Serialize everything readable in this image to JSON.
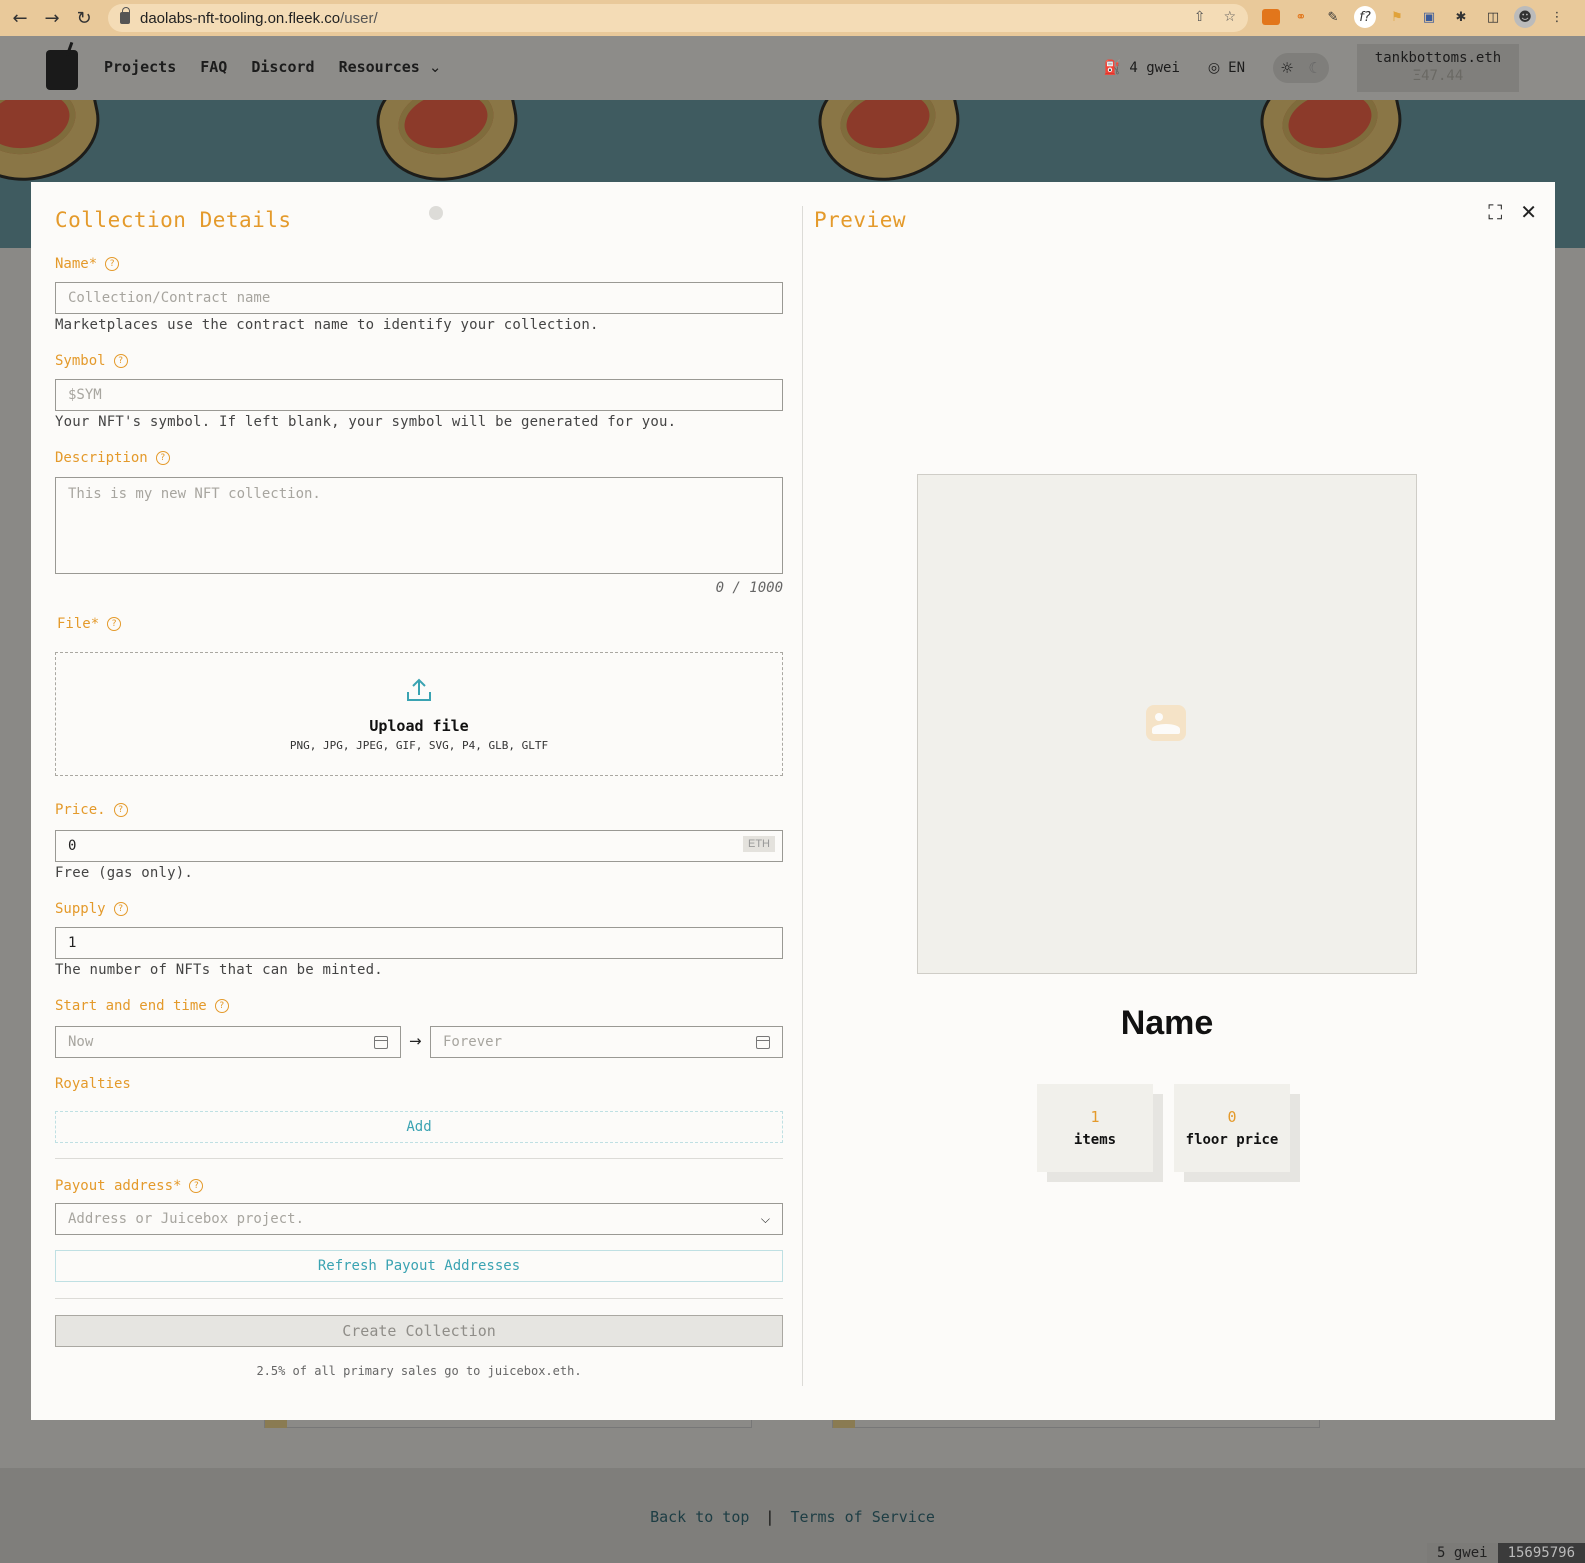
{
  "browser": {
    "url_host": "daolabs-nft-tooling.on.fleek.co",
    "url_path": "/user/"
  },
  "app": {
    "nav": [
      "Projects",
      "FAQ",
      "Discord",
      "Resources"
    ],
    "gas": "4 gwei",
    "language": "EN",
    "wallet_name": "tankbottoms.eth",
    "wallet_balance": "Ξ47.44",
    "footer_back_to_top": "Back to top",
    "footer_separator": "|",
    "footer_terms": "Terms of Service",
    "status_gas": "5 gwei",
    "status_block": "15695796"
  },
  "form": {
    "title": "Collection Details",
    "name_label": "Name*",
    "name_placeholder": "Collection/Contract name",
    "name_hint": "Marketplaces use the contract name to identify your collection.",
    "symbol_label": "Symbol",
    "symbol_placeholder": "$SYM",
    "symbol_hint": "Your NFT's symbol. If left blank, your symbol will be generated for you.",
    "description_label": "Description",
    "description_placeholder": "This is my new NFT collection.",
    "description_counter": "0 / 1000",
    "file_label": "File*",
    "upload_title": "Upload file",
    "upload_types": "PNG, JPG, JPEG, GIF, SVG, P4, GLB, GLTF",
    "price_label": "Price.",
    "price_value": "0",
    "price_unit": "ETH",
    "price_hint": "Free (gas only).",
    "supply_label": "Supply",
    "supply_value": "1",
    "supply_hint": "The number of NFTs that can be minted.",
    "time_label": "Start and end time",
    "start_placeholder": "Now",
    "end_placeholder": "Forever",
    "royalties_label": "Royalties",
    "add_label": "Add",
    "payout_label": "Payout address*",
    "payout_placeholder": "Address or Juicebox project.",
    "refresh_label": "Refresh Payout Addresses",
    "create_label": "Create Collection",
    "fee_note": "2.5% of all primary sales go to juicebox.eth."
  },
  "preview": {
    "title": "Preview",
    "name": "Name",
    "items_value": "1",
    "items_label": "items",
    "floor_value": "0",
    "floor_label": "floor price"
  },
  "colors": {
    "accent": "#e49a2b",
    "link": "#3aa3b2"
  }
}
